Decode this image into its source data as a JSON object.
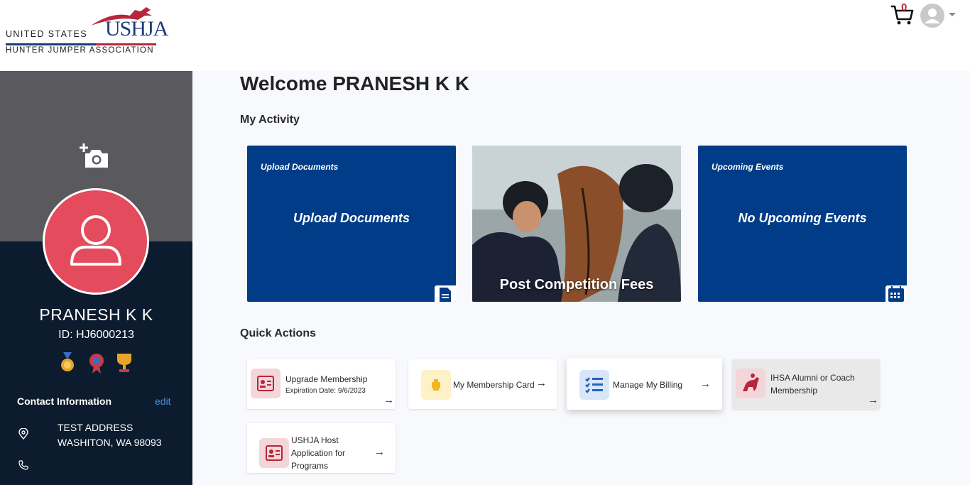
{
  "brand": {
    "line1": "UNITED STATES",
    "mark": "USHJA",
    "line2": "HUNTER JUMPER ASSOCIATION"
  },
  "header": {
    "cart_count": "0",
    "cart_icon": "shopping-cart-icon",
    "account_icon": "user-avatar-icon"
  },
  "profile": {
    "name": "PRANESH K K",
    "id_label": "ID: HJ6000213",
    "badges": [
      "medal-icon",
      "rosette-icon",
      "trophy-icon"
    ]
  },
  "contact": {
    "title": "Contact Information",
    "edit_label": "edit",
    "address_line1": "TEST ADDRESS",
    "address_line2": "WASHITON, WA 98093"
  },
  "main": {
    "welcome": "Welcome PRANESH K K",
    "activity_title": "My Activity",
    "quick_title": "Quick Actions"
  },
  "activity_cards": [
    {
      "small": "Upload Documents",
      "big": "Upload Documents",
      "icon": "document-icon"
    },
    {
      "caption": "Post Competition Fees"
    },
    {
      "small": "Upcoming Events",
      "big": "No Upcoming Events",
      "icon": "calendar-icon"
    }
  ],
  "quick_actions": [
    {
      "title": "Upgrade Membership",
      "subtitle": "Expiration Date: 9/6/2023",
      "arrow": "→"
    },
    {
      "title": "My Membership Card",
      "arrow": "→"
    },
    {
      "title": "Manage My Billing",
      "arrow": "→"
    },
    {
      "title_line1": "IHSA Alumni or Coach",
      "title_line2": "Membership",
      "arrow": "→"
    },
    {
      "title_line1": "USHJA Host",
      "title_line2": "Application for",
      "title_line3": "Programs",
      "arrow": "→"
    }
  ],
  "colors": {
    "card_blue": "#003c87",
    "sidebar_dark": "#0d1b2e",
    "avatar_red": "#e44b5c",
    "link_blue": "#4a8fe0"
  }
}
